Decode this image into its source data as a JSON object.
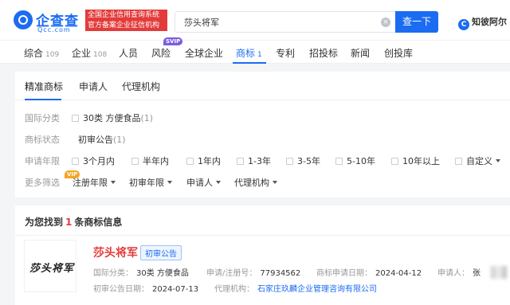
{
  "header": {
    "logo_cn": "企查查",
    "logo_en": "Qcc.com",
    "slogan_line1": "全国企业信用查询系统",
    "slogan_line2": "官方备案企业征信机构",
    "search_value": "莎头将军",
    "search_button": "查一下",
    "zhibi_label": "知彼阿尔"
  },
  "nav": {
    "items": [
      {
        "label": "综合",
        "count": "109"
      },
      {
        "label": "企业",
        "count": "108"
      },
      {
        "label": "人员",
        "count": ""
      },
      {
        "label": "风险",
        "count": ""
      },
      {
        "label": "全球企业",
        "count": ""
      },
      {
        "label": "商标",
        "count": "1"
      },
      {
        "label": "专利",
        "count": ""
      },
      {
        "label": "招投标",
        "count": ""
      },
      {
        "label": "新闻",
        "count": ""
      },
      {
        "label": "创投库",
        "count": ""
      }
    ],
    "svip_badge": "SVIP",
    "active_index": 5
  },
  "filters": {
    "subtabs": [
      "精准商标",
      "申请人",
      "代理机构"
    ],
    "category_label": "国际分类",
    "category_option": "30类 方便食品",
    "category_count": "(1)",
    "status_label": "商标状态",
    "status_option": "初审公告",
    "status_count": "(1)",
    "year_label": "申请年限",
    "year_options": [
      "3个月内",
      "半年内",
      "1年内",
      "1-3年",
      "3-5年",
      "5-10年",
      "10年以上",
      "自定义"
    ],
    "more_label": "更多筛选",
    "vip_badge": "VIP",
    "more_dropdowns": [
      "注册年限",
      "初审年限",
      "申请人",
      "代理机构"
    ]
  },
  "results": {
    "found_prefix": "为您找到",
    "found_count": "1",
    "found_suffix": "条商标信息",
    "items": [
      {
        "image_text": "莎头将军",
        "name": "莎头将军",
        "status_badge": "初审公告",
        "class_label": "国际分类：",
        "class_value": "30类 方便食品",
        "reg_label": "申请/注册号：",
        "reg_value": "77934562",
        "apply_date_label": "商标申请日期：",
        "apply_date_value": "2024-04-12",
        "applicant_label": "申请人：",
        "applicant_value": "张",
        "pub_date_label": "初审公告日期：",
        "pub_date_value": "2024-07-13",
        "agent_label": "代理机构：",
        "agent_value": "石家庄玖麟企业管理咨询有限公司"
      }
    ]
  },
  "colors": {
    "brand": "#1b6cf2",
    "red": "#e33b3b",
    "bg": "#f3f5f7"
  }
}
